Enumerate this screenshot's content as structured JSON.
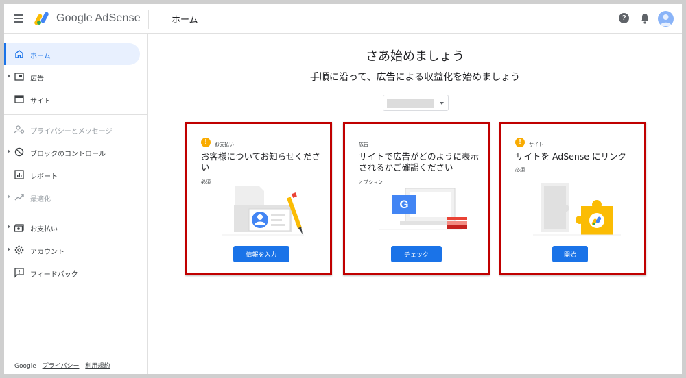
{
  "topbar": {
    "brand": "Google AdSense",
    "page_title": "ホーム",
    "help": "?"
  },
  "sidebar": {
    "items": [
      {
        "label": "ホーム",
        "icon": "home-icon",
        "state": "active"
      },
      {
        "label": "広告",
        "icon": "ads-icon",
        "state": "normal"
      },
      {
        "label": "サイト",
        "icon": "sites-icon",
        "state": "normal"
      },
      {
        "label": "プライバシーとメッセージ",
        "icon": "privacy-icon",
        "state": "disabled"
      },
      {
        "label": "ブロックのコントロール",
        "icon": "block-icon",
        "state": "normal"
      },
      {
        "label": "レポート",
        "icon": "reports-icon",
        "state": "normal"
      },
      {
        "label": "最適化",
        "icon": "optimization-icon",
        "state": "disabled"
      },
      {
        "label": "お支払い",
        "icon": "payments-icon",
        "state": "normal"
      },
      {
        "label": "アカウント",
        "icon": "account-gear-icon",
        "state": "normal"
      },
      {
        "label": "フィードバック",
        "icon": "feedback-icon",
        "state": "normal"
      }
    ],
    "footer": {
      "google": "Google",
      "privacy": "プライバシー",
      "terms": "利用規約"
    }
  },
  "main": {
    "title": "さあ始めましょう",
    "subtitle": "手順に沿って、広告による収益化を始めましょう",
    "cards": [
      {
        "tag": "お支払い",
        "warning": true,
        "title": "お客様についてお知らせください",
        "sub": "必須",
        "button": "情報を入力"
      },
      {
        "tag": "広告",
        "warning": false,
        "title": "サイトで広告がどのように表示されるかご確認ください",
        "sub": "オプション",
        "button": "チェック"
      },
      {
        "tag": "サイト",
        "warning": true,
        "title": "サイトを AdSense にリンク",
        "sub": "必須",
        "button": "開始"
      }
    ],
    "g_letter": "G"
  },
  "colors": {
    "accent": "#1a73e8",
    "active_bg": "#e8f0fe",
    "highlight_border": "#c00000",
    "warning": "#f9ab00"
  }
}
